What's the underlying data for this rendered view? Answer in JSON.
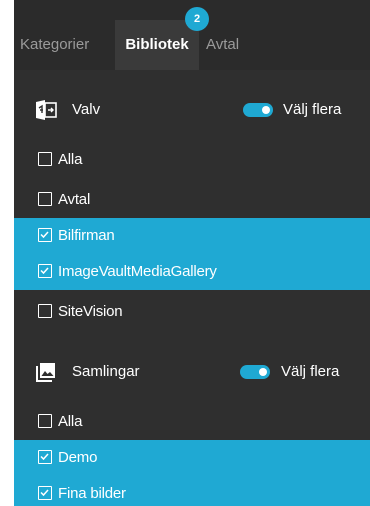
{
  "tabs": [
    {
      "label": "Kategorier",
      "active": false
    },
    {
      "label": "Bibliotek",
      "active": true
    },
    {
      "label": "Avtal",
      "active": false
    }
  ],
  "badge": "2",
  "sections": [
    {
      "title": "Valv",
      "icon": "vault-icon",
      "toggle_label": "Välj flera",
      "toggle_on": true,
      "items": [
        {
          "label": "Alla",
          "checked": false
        },
        {
          "label": "Avtal",
          "checked": false
        },
        {
          "label": "Bilfirman",
          "checked": true
        },
        {
          "label": "ImageVaultMediaGallery",
          "checked": true
        },
        {
          "label": "SiteVision",
          "checked": false
        }
      ]
    },
    {
      "title": "Samlingar",
      "icon": "collections-icon",
      "toggle_label": "Välj flera",
      "toggle_on": true,
      "items": [
        {
          "label": "Alla",
          "checked": false
        },
        {
          "label": "Demo",
          "checked": true
        },
        {
          "label": "Fina bilder",
          "checked": true
        }
      ]
    }
  ],
  "colors": {
    "accent": "#1fa9d3",
    "panel": "#2f2f2f",
    "tabbar": "#2b2b2b"
  }
}
